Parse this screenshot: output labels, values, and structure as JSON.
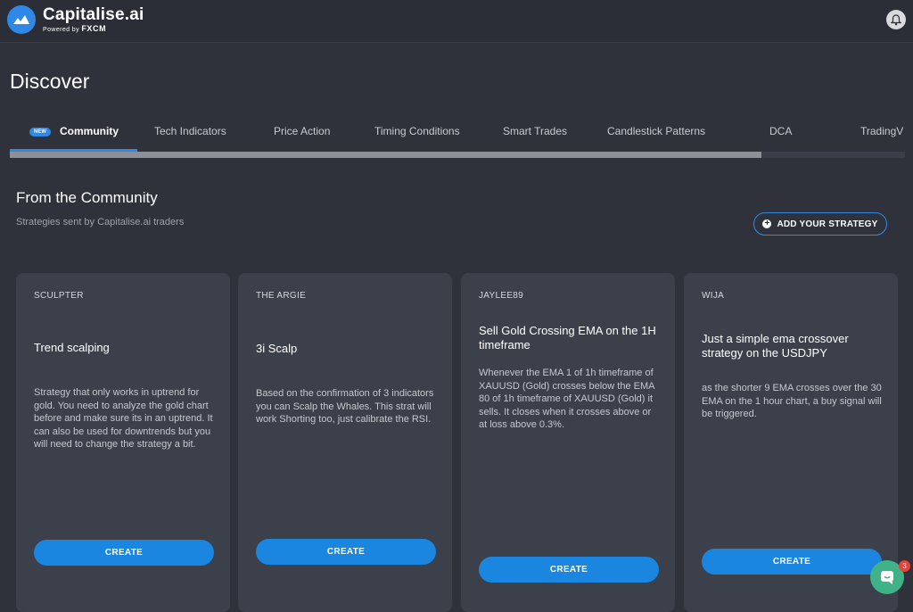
{
  "header": {
    "brand_name": "Capitalise.ai",
    "powered_by": "Powered by",
    "partner": "FXCM",
    "logo_icon": "capitalise-logo-icon",
    "notification_icon": "bell-icon"
  },
  "page": {
    "title": "Discover"
  },
  "tabs": [
    {
      "label": "Community",
      "badge": "NEW",
      "active": true
    },
    {
      "label": "Tech Indicators"
    },
    {
      "label": "Price Action"
    },
    {
      "label": "Timing Conditions"
    },
    {
      "label": "Smart Trades"
    },
    {
      "label": "Candlestick Patterns"
    },
    {
      "label": "DCA"
    },
    {
      "label": "TradingV"
    }
  ],
  "section": {
    "title": "From the Community",
    "subtitle": "Strategies sent by Capitalise.ai traders",
    "add_button": "ADD YOUR STRATEGY",
    "add_icon": "plus-circle-icon"
  },
  "cards": [
    {
      "author": "SCULPTER",
      "title": "Trend scalping",
      "description": "Strategy that only works in uptrend for gold. You need to analyze the gold chart before and make sure its in an uptrend. It can also be used for downtrends but you will need to change the strategy a bit.",
      "button": "CREATE"
    },
    {
      "author": "THE ARGIE",
      "title": "3i Scalp",
      "description": "Based on the confirmation of 3 indicators you can Scalp the Whales. This strat will work Shorting too, just calibrate the RSI.",
      "button": "CREATE"
    },
    {
      "author": "JAYLEE89",
      "title": "Sell Gold Crossing EMA on the 1H timeframe",
      "description": "Whenever the EMA 1 of 1h timeframe of XAUUSD (Gold) crosses below the EMA 80 of 1h timeframe of XAUUSD (Gold) it sells. It closes when it crosses above or at loss above 0.3%.",
      "button": "CREATE"
    },
    {
      "author": "WIJA",
      "title": "Just a simple ema crossover strategy on the USDJPY",
      "description": "as the shorter 9 EMA crosses over the 30 EMA on the 1 hour chart, a buy signal will be triggered.",
      "button": "CREATE"
    }
  ],
  "chat": {
    "icon": "chat-bubble-icon",
    "unread_count": "3"
  },
  "colors": {
    "accent": "#1a86e0",
    "background": "#2f323a",
    "card": "#3b404a",
    "chat": "#3fb387"
  }
}
